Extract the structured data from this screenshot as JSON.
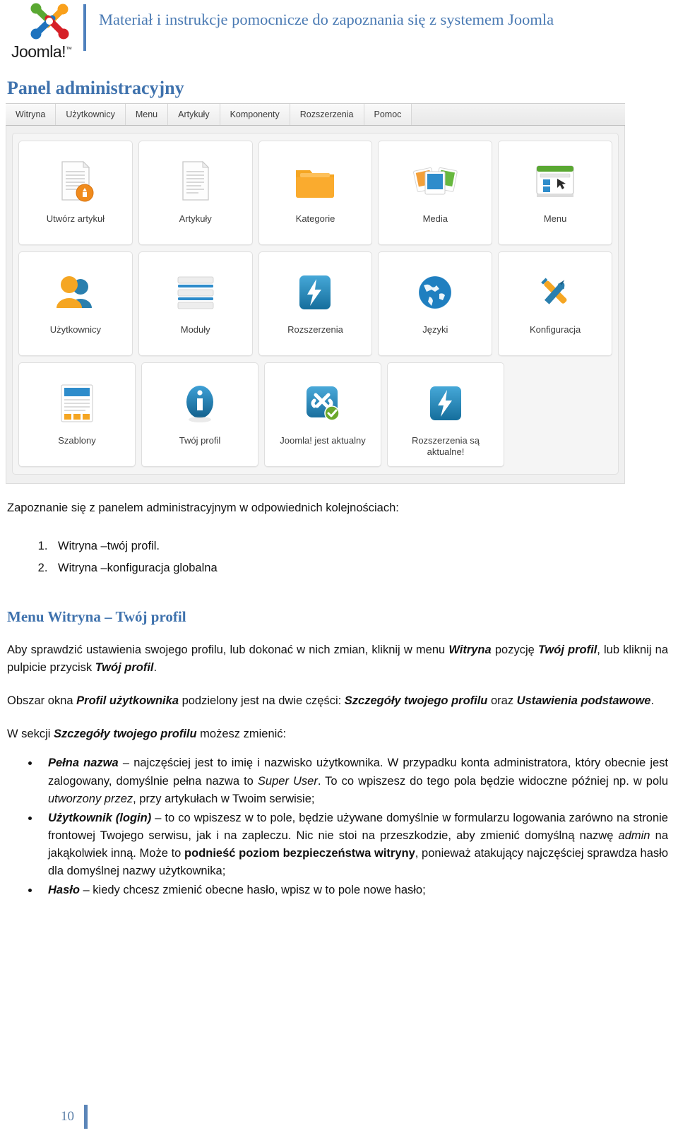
{
  "header": {
    "logo_text": "Joomla!",
    "logo_tm": "™",
    "title": "Materiał i instrukcje pomocnicze do zapoznania się z systemem Joomla",
    "accent_color": "#4f81bd",
    "title_color": "#4a7ab3"
  },
  "page_title": "Panel administracyjny",
  "admin_panel": {
    "tabs": [
      {
        "label": "Witryna"
      },
      {
        "label": "Użytkownicy"
      },
      {
        "label": "Menu"
      },
      {
        "label": "Artykuły"
      },
      {
        "label": "Komponenty"
      },
      {
        "label": "Rozszerzenia"
      },
      {
        "label": "Pomoc"
      }
    ],
    "rows": [
      [
        {
          "label": "Utwórz artykuł",
          "icon": "new-article-icon"
        },
        {
          "label": "Artykuły",
          "icon": "article-icon"
        },
        {
          "label": "Kategorie",
          "icon": "folder-icon"
        },
        {
          "label": "Media",
          "icon": "media-images-icon"
        },
        {
          "label": "Menu",
          "icon": "menu-window-icon"
        }
      ],
      [
        {
          "label": "Użytkownicy",
          "icon": "users-icon"
        },
        {
          "label": "Moduły",
          "icon": "modules-icon"
        },
        {
          "label": "Rozszerzenia",
          "icon": "extensions-bolt-icon"
        },
        {
          "label": "Języki",
          "icon": "globe-icon"
        },
        {
          "label": "Konfiguracja",
          "icon": "tools-icon"
        }
      ],
      [
        {
          "label": "Szablony",
          "icon": "template-icon"
        },
        {
          "label": "Twój profil",
          "icon": "info-icon"
        },
        {
          "label": "Joomla! jest aktualny",
          "icon": "joomla-check-icon"
        },
        {
          "label": "Rozszerzenia są aktualne!",
          "icon": "extensions-bolt-icon"
        }
      ]
    ]
  },
  "content": {
    "lead": "Zapoznanie się z panelem administracyjnym w odpowiednich kolejnościach:",
    "numbered": [
      "Witryna –twój profil.",
      "Witryna –konfiguracja globalna"
    ],
    "section_heading": "Menu Witryna – Twój profil",
    "p1": {
      "t1": "Aby sprawdzić ustawienia swojego profilu, lub dokonać w nich zmian, kliknij w menu ",
      "b1": "Witryna",
      "t2": " pozycję ",
      "b2": "Twój profil",
      "t3": ", lub kliknij na pulpicie przycisk ",
      "b3": "Twój profil",
      "t4": "."
    },
    "p2": {
      "t1": "Obszar okna ",
      "b1": "Profil użytkownika",
      "t2": " podzielony jest na dwie części: ",
      "b2": "Szczegóły twojego profilu",
      "t3": " oraz ",
      "b3": "Ustawienia podstawowe",
      "t4": "."
    },
    "p3": {
      "t1": "W sekcji ",
      "b1": "Szczegóły twojego profilu",
      "t2": " możesz zmienić:"
    },
    "bullets": [
      {
        "b1": "Pełna nazwa",
        "t1": " – najczęściej jest to imię i nazwisko użytkownika. W przypadku konta administratora, który obecnie jest zalogowany, domyślnie pełna nazwa to ",
        "i1": "Super User",
        "t2": ". To co wpiszesz do tego pola będzie widoczne później np. w polu ",
        "i2": "utworzony przez",
        "t3": ", przy artykułach w Twoim serwisie;"
      },
      {
        "b1": "Użytkownik (login)",
        "t1": " – to co wpiszesz w to pole, będzie używane domyślnie w formularzu logowania zarówno na stronie frontowej Twojego serwisu, jak i na zapleczu. Nic nie stoi na przeszkodzie, aby zmienić domyślną nazwę ",
        "i1": "admin",
        "t2": " na jakąkolwiek inną. Może to ",
        "b2": "podnieść poziom bezpieczeństwa witryny",
        "t3": ", ponieważ atakujący najczęściej sprawdza hasło dla domyślnej nazwy użytkownika;"
      },
      {
        "b1": "Hasło",
        "t1": " – kiedy chcesz zmienić obecne hasło, wpisz w to pole nowe hasło;",
        "i1": "",
        "t2": "",
        "b2": "",
        "t3": ""
      }
    ]
  },
  "footer": {
    "page_number": "10",
    "bar_color": "#5b85b8"
  }
}
